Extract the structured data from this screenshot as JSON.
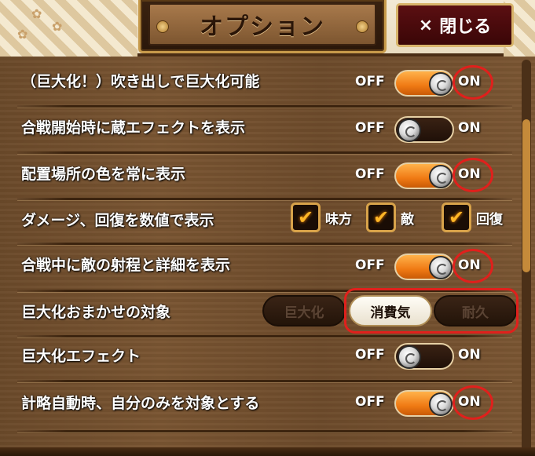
{
  "header": {
    "title": "オプション",
    "close_label": "閉じる",
    "close_icon": "×"
  },
  "toggle_labels": {
    "off": "OFF",
    "on": "ON"
  },
  "rows": [
    {
      "label": "（巨大化！）吹き出しで巨大化可能",
      "type": "toggle",
      "state": "on",
      "highlighted": true
    },
    {
      "label": "合戦開始時に蔵エフェクトを表示",
      "type": "toggle",
      "state": "off",
      "highlighted": false
    },
    {
      "label": "配置場所の色を常に表示",
      "type": "toggle",
      "state": "on",
      "highlighted": true
    },
    {
      "label": "ダメージ、回復を数値で表示",
      "type": "checkboxes",
      "options": [
        {
          "label": "味方",
          "checked": true
        },
        {
          "label": "敵",
          "checked": true
        },
        {
          "label": "回復",
          "checked": true
        }
      ]
    },
    {
      "label": "合戦中に敵の射程と詳細を表示",
      "type": "toggle",
      "state": "on",
      "highlighted": true
    },
    {
      "label": "巨大化おまかせの対象",
      "type": "segmented",
      "options": [
        {
          "label": "巨大化",
          "active": false
        },
        {
          "label": "消費気",
          "active": true
        },
        {
          "label": "耐久",
          "active": false
        }
      ]
    },
    {
      "label": "巨大化エフェクト",
      "type": "toggle",
      "state": "off",
      "highlighted": false
    },
    {
      "label": "計略自動時、自分のみを対象とする",
      "type": "toggle",
      "state": "on",
      "highlighted": true
    }
  ],
  "colors": {
    "toggle_on": "#f07a14",
    "highlight": "#e0201c",
    "checkmark": "#ffb627"
  }
}
